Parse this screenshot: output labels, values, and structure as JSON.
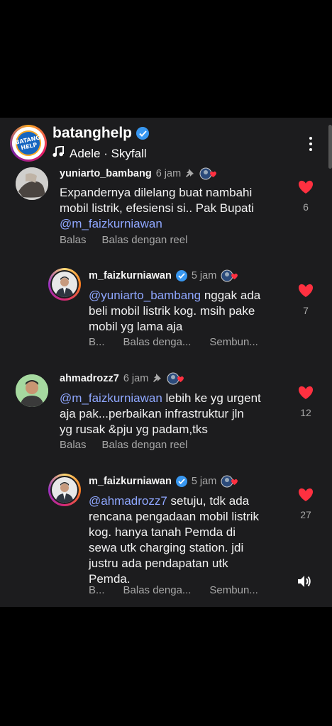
{
  "header": {
    "page_name": "batanghelp",
    "logo_text": "BATANG HELP",
    "music": "Adele · Skyfall"
  },
  "comments": [
    {
      "username": "yuniarto_bambang",
      "time": "6 jam",
      "pinned": true,
      "text_lines": [
        "Expandernya dilelang buat nambahi",
        "mobil listrik, efesiensi si.. Pak Bupati"
      ],
      "mention": "@m_faizkurniawan",
      "actions": [
        "Balas",
        "Balas dengan reel"
      ],
      "likes": "6"
    },
    {
      "username": "m_faizkurniawan",
      "verified": true,
      "time": "5 jam",
      "mention": "@yuniarto_bambang",
      "text_after_mention": " nggak ada",
      "text_lines": [
        "beli mobil listrik kog. msih pake",
        "mobil yg lama aja"
      ],
      "actions": [
        "B...",
        "Balas denga...",
        "Sembun..."
      ],
      "likes": "7"
    },
    {
      "username": "ahmadrozz7",
      "time": "6 jam",
      "pinned": true,
      "mention": "@m_faizkurniawan",
      "text_after_mention": " lebih ke yg urgent",
      "text_lines": [
        "aja pak...perbaikan infrastruktur jln",
        "yg rusak &pju yg padam,tks"
      ],
      "actions": [
        "Balas",
        "Balas dengan reel"
      ],
      "likes": "12"
    },
    {
      "username": "m_faizkurniawan",
      "verified": true,
      "time": "5 jam",
      "mention": "@ahmadrozz7",
      "text_after_mention": " setuju, tdk ada",
      "text_lines": [
        "rencana pengadaan mobil listrik",
        "kog. hanya tanah Pemda di",
        "sewa utk charging station. jdi",
        "justru ada pendapatan utk",
        "Pemda."
      ],
      "actions": [
        "B...",
        "Balas denga...",
        "Sembun..."
      ],
      "likes": "27"
    }
  ],
  "colors": {
    "background": "#000000",
    "panel": "#1c1c1e",
    "mention": "#8fa7ff",
    "heart": "#ff3040",
    "verified": "#3897f0",
    "muted": "#a8a8a8"
  },
  "icons": [
    "verified-icon",
    "music-note-icon",
    "more-icon",
    "pin-icon",
    "creator-badge-icon",
    "heart-icon",
    "volume-icon"
  ]
}
